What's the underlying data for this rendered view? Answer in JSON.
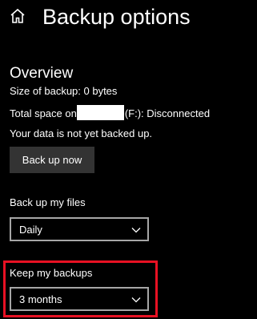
{
  "header": {
    "title": "Backup options",
    "home_icon": "home-icon"
  },
  "overview": {
    "title": "Overview",
    "size_text": "Size of backup: 0 bytes",
    "total_space_prefix": "Total space on",
    "total_space_suffix": "(F:): Disconnected",
    "status_text": "Your data is not yet backed up.",
    "back_up_now_label": "Back up now"
  },
  "backup_frequency": {
    "label": "Back up my files",
    "selected": "Daily"
  },
  "keep_backups": {
    "label": "Keep my backups",
    "selected": "3 months"
  },
  "colors": {
    "background": "#000000",
    "text": "#ffffff",
    "button": "#333333",
    "select_border": "#a6a6a6",
    "highlight": "#e81123"
  }
}
